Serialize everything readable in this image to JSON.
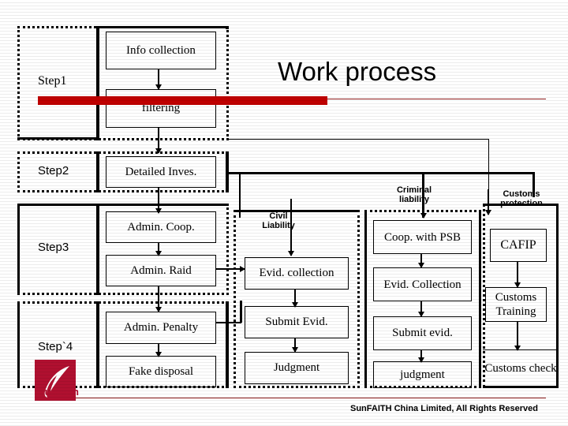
{
  "slide": {
    "title": "Work process",
    "footer": "SunFAITH China Limited, All Rights Reserved",
    "logo_text": "Sunfaith",
    "accent_color": "#c00000",
    "rule_color": "#8b1a1a",
    "logo_color": "#b01030"
  },
  "steps": [
    {
      "label": "Step1",
      "nodes": [
        "Info collection",
        "filtering"
      ]
    },
    {
      "label": "Step2",
      "nodes": [
        "Detailed Inves."
      ]
    },
    {
      "label": "Step3",
      "nodes": [
        "Admin. Coop.",
        "Admin. Raid"
      ]
    },
    {
      "label": "Step`4",
      "nodes": [
        "Admin. Penalty",
        "Fake disposal"
      ]
    }
  ],
  "branches": [
    {
      "label": "Civil\nLiability",
      "label_line1": "Civil",
      "label_line2": "Liability",
      "nodes": [
        "Evid. collection",
        "Submit Evid.",
        "Judgment"
      ]
    },
    {
      "label": "Criminal\nliability",
      "label_line1": "Criminal",
      "label_line2": "liability",
      "nodes": [
        "Coop. with PSB",
        "Evid. Collection",
        "Submit evid.",
        "judgment"
      ]
    },
    {
      "label": "Customs\nprotection",
      "label_line1": "Customs",
      "label_line2": "protection",
      "nodes": [
        "CAFIP",
        "Customs Training",
        "Customs check"
      ]
    }
  ],
  "nodes": {
    "info_collection": "Info collection",
    "filtering": "filtering",
    "detailed_inves": "Detailed Inves.",
    "admin_coop": "Admin. Coop.",
    "admin_raid": "Admin. Raid",
    "admin_penalty": "Admin. Penalty",
    "fake_disposal": "Fake disposal",
    "evid_collection_civil": "Evid. collection",
    "submit_evid_civil": "Submit Evid.",
    "judgment_civil": "Judgment",
    "coop_with_psb": "Coop. with PSB",
    "evid_collection_crim": "Evid. Collection",
    "submit_evid_crim": "Submit evid.",
    "judgment_crim": "judgment",
    "cafip": "CAFIP",
    "customs_training": "Customs Training",
    "customs_check": "Customs check"
  }
}
